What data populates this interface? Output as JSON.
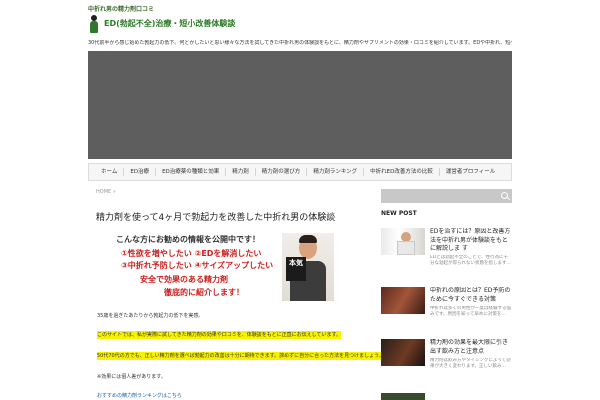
{
  "site": {
    "tagline": "中折れ男の精力剤口コミ",
    "title": "ED(勃起不全)治療・短小改善体験談",
    "intro": "30代前半から感じ始めた勃起力の低下。何とかしたいと思い様々な方法を試してきた中折れ男の体験談をもとに、精力剤やサプリメントの効果・口コミを紹介しています。EDや中折れ、短小に悩んでいる方の参考になれば幸いです。本当に効果のあった精力剤だけを厳選して紹介しています。"
  },
  "nav": {
    "items": [
      "ホーム",
      "ED治療",
      "ED治療薬の種類と効果",
      "精力剤",
      "精力剤の選び方",
      "精力剤ランキング",
      "中折れED改善方法の比較",
      "運営者プロフィール"
    ]
  },
  "main": {
    "breadcrumb": "HOME »",
    "post_title": "精力剤を使って4ヶ月で勃起力を改善した中折れ男の体験談",
    "banner": {
      "line1": "こんな方にお勧めの情報を公開中です！",
      "line2": "①性欲を増やしたい ②EDを解消したい",
      "line3": "③中折れ予防したい ④サイズアップしたい",
      "line4": "安全で効果のある精力剤",
      "line5": "徹底的に紹介します！",
      "sign": "本気"
    },
    "paragraphs": [
      "35歳を過ぎたあたりから勃起力の低下を実感。",
      "このサイトでは、私が実際に試してきた精力剤の効果や口コミを、体験談をもとに正直にお伝えしています。",
      "50代70代の方でも、正しい精力剤を選べば勃起力の改善は十分に期待できます。諦めずに自分に合った方法を見つけましょう。",
      "※効果には個人差があります。",
      "おすすめの精力剤ランキングはこちら"
    ]
  },
  "sidebar": {
    "search_placeholder": "",
    "new_post_heading": "NEW POST",
    "posts": [
      {
        "title": "EDを治すには？原因と改善方法を中折れ男が体験談をもとに解説しま す",
        "excerpt": "EDとは勃起不全のことで、性行為に十分な勃起が得られない状態を指します…"
      },
      {
        "title": "中折れの原因とは？ED予防のために今すぐできる対策",
        "excerpt": "中折れは多くの男性が一度は経験する悩みです。原因を知って早めに対策を…"
      },
      {
        "title": "精力剤の効果を最大限に引き出す飲み方と注意点",
        "excerpt": "精力剤は飲み方やタイミングによって効果が大きく変わります。正しい飲み…"
      }
    ]
  }
}
